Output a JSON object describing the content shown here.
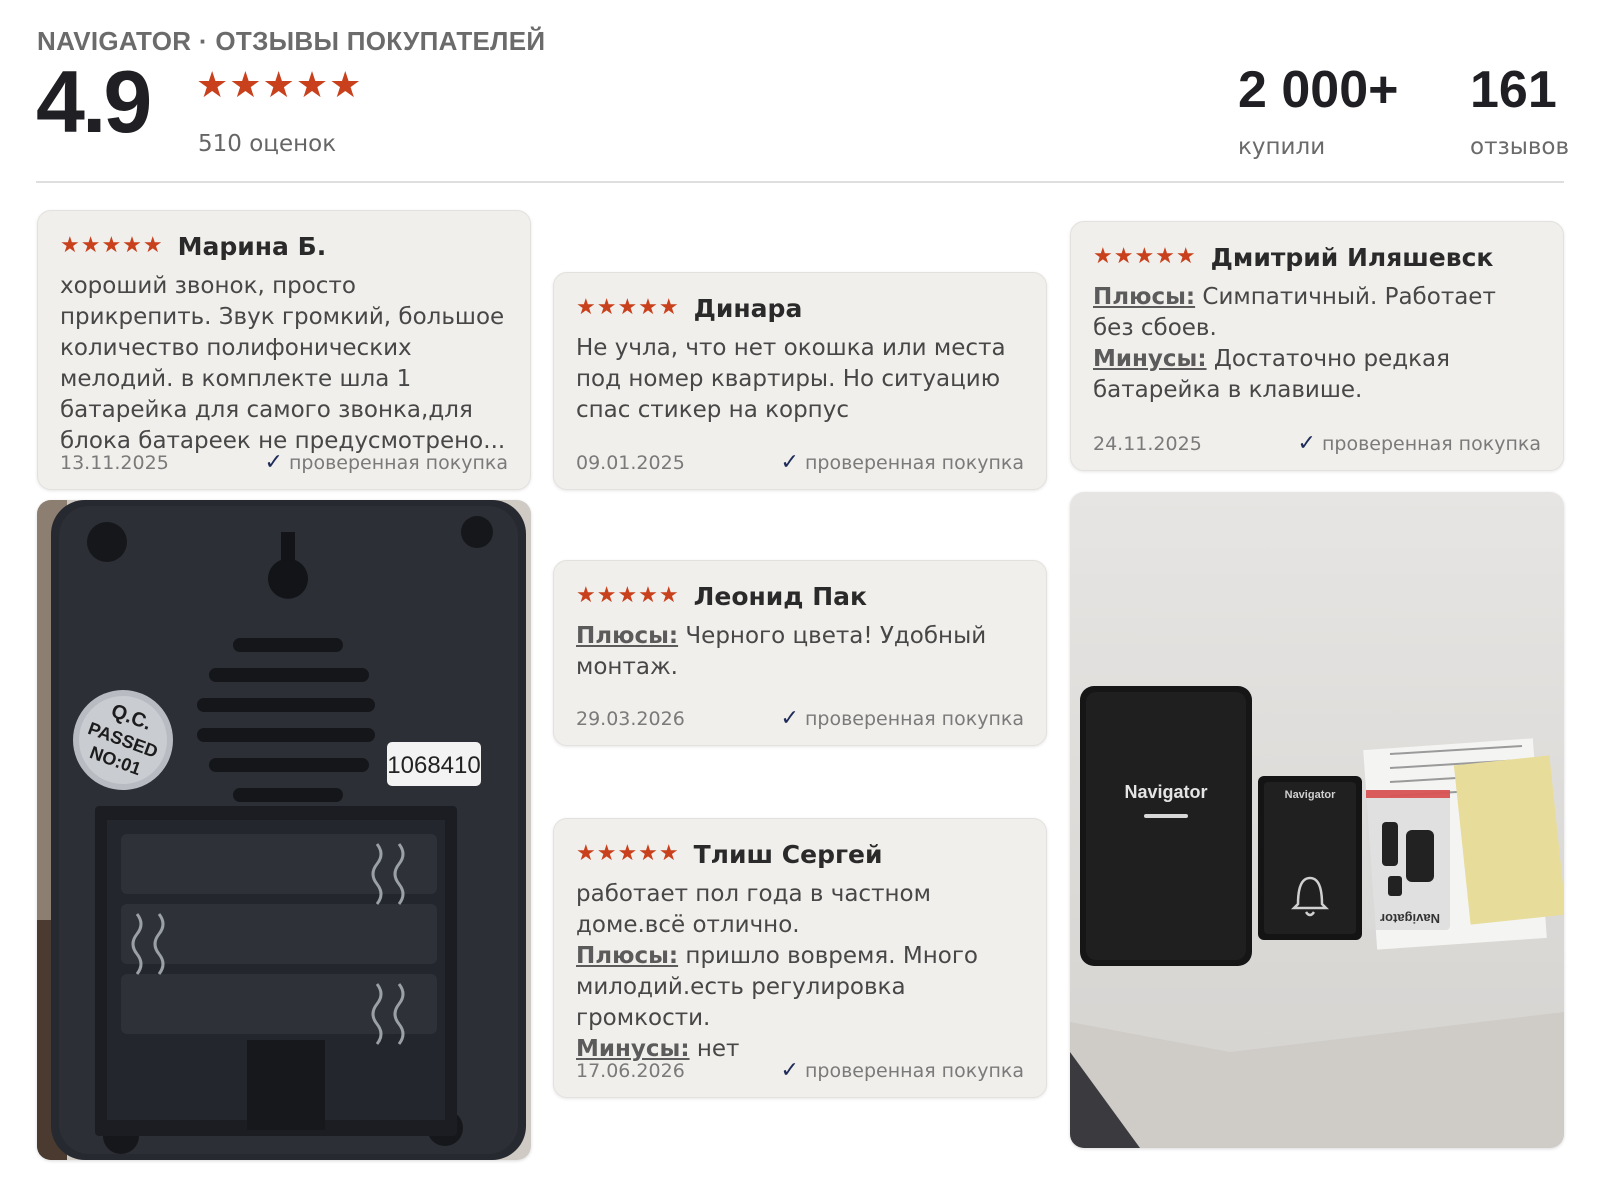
{
  "header": {
    "brand": "NAVIGATOR · ОТЗЫВЫ ПОКУПАТЕЛЕЙ",
    "rating": "4.9",
    "stars": "★★★★★",
    "ratings_count": "510 оценок",
    "stats": {
      "bought_value": "2 000+",
      "bought_label": "купили",
      "reviews_value": "161",
      "reviews_label": "отзывов"
    }
  },
  "verified_label": "проверенная покупка",
  "reviews": [
    {
      "stars": "★★★★★",
      "author": "Марина Б.",
      "text": "хороший звонок, просто прикрепить. Звук громкий, большое количество полифонических мелодий. в комплекте шла 1 батарейка для самого звонка,для блока батареек не предусмотрено...",
      "date": "13.11.2025"
    },
    {
      "stars": "★★★★★",
      "author": "Динара",
      "text": "Не учла, что нет окошка или места под номер квартиры. Но ситуацию спас стикер на корпус",
      "date": "09.01.2025"
    },
    {
      "stars": "★★★★★",
      "author": "Дмитрий Иляшевск",
      "pros_label": "Плюсы:",
      "pros": "Симпатичный. Работает без сбоев.",
      "cons_label": "Минусы:",
      "cons": "Достаточно редкая батарейка в клавише.",
      "date": "24.11.2025"
    },
    {
      "stars": "★★★★★",
      "author": "Леонид Пак",
      "pros_label": "Плюсы:",
      "pros": "Черного цвета! Удобный монтаж.",
      "date": "29.03.2026"
    },
    {
      "stars": "★★★★★",
      "author": "Тлиш Сергей",
      "text": "работает пол года в частном доме.всё отлично.",
      "pros_label": "Плюсы:",
      "pros": "пришло вовремя. Много милодий.есть регулировка громкости.",
      "cons_label": "Минусы:",
      "cons": "нет",
      "date": "17.06.2026"
    }
  ],
  "photos": {
    "left": {
      "qc_line1": "Q.C.",
      "qc_line2": "PASSED",
      "qc_line3": "NO:01",
      "serial": "1068410"
    },
    "right": {
      "brand_receiver": "Navigator",
      "brand_button": "Navigator",
      "brand_box": "Navigator"
    }
  }
}
